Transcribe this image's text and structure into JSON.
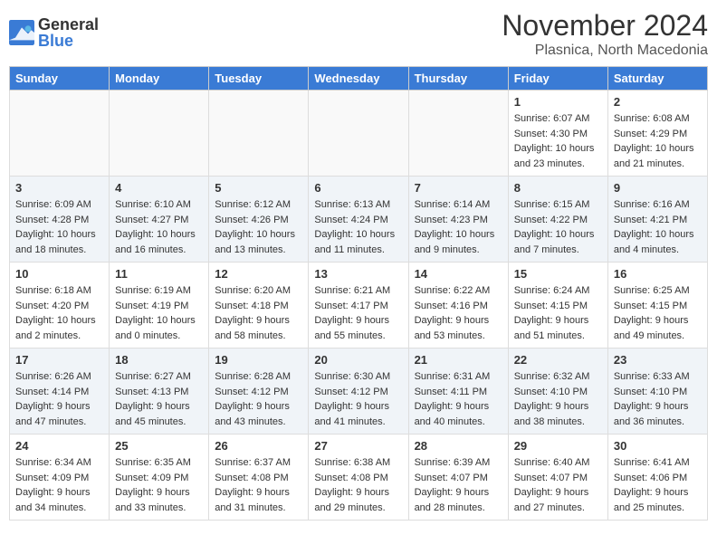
{
  "logo": {
    "general": "General",
    "blue": "Blue"
  },
  "title": "November 2024",
  "location": "Plasnica, North Macedonia",
  "days_of_week": [
    "Sunday",
    "Monday",
    "Tuesday",
    "Wednesday",
    "Thursday",
    "Friday",
    "Saturday"
  ],
  "weeks": [
    [
      {
        "day": "",
        "info": "",
        "empty": true
      },
      {
        "day": "",
        "info": "",
        "empty": true
      },
      {
        "day": "",
        "info": "",
        "empty": true
      },
      {
        "day": "",
        "info": "",
        "empty": true
      },
      {
        "day": "",
        "info": "",
        "empty": true
      },
      {
        "day": "1",
        "info": "Sunrise: 6:07 AM\nSunset: 4:30 PM\nDaylight: 10 hours and 23 minutes."
      },
      {
        "day": "2",
        "info": "Sunrise: 6:08 AM\nSunset: 4:29 PM\nDaylight: 10 hours and 21 minutes."
      }
    ],
    [
      {
        "day": "3",
        "info": "Sunrise: 6:09 AM\nSunset: 4:28 PM\nDaylight: 10 hours and 18 minutes."
      },
      {
        "day": "4",
        "info": "Sunrise: 6:10 AM\nSunset: 4:27 PM\nDaylight: 10 hours and 16 minutes."
      },
      {
        "day": "5",
        "info": "Sunrise: 6:12 AM\nSunset: 4:26 PM\nDaylight: 10 hours and 13 minutes."
      },
      {
        "day": "6",
        "info": "Sunrise: 6:13 AM\nSunset: 4:24 PM\nDaylight: 10 hours and 11 minutes."
      },
      {
        "day": "7",
        "info": "Sunrise: 6:14 AM\nSunset: 4:23 PM\nDaylight: 10 hours and 9 minutes."
      },
      {
        "day": "8",
        "info": "Sunrise: 6:15 AM\nSunset: 4:22 PM\nDaylight: 10 hours and 7 minutes."
      },
      {
        "day": "9",
        "info": "Sunrise: 6:16 AM\nSunset: 4:21 PM\nDaylight: 10 hours and 4 minutes."
      }
    ],
    [
      {
        "day": "10",
        "info": "Sunrise: 6:18 AM\nSunset: 4:20 PM\nDaylight: 10 hours and 2 minutes."
      },
      {
        "day": "11",
        "info": "Sunrise: 6:19 AM\nSunset: 4:19 PM\nDaylight: 10 hours and 0 minutes."
      },
      {
        "day": "12",
        "info": "Sunrise: 6:20 AM\nSunset: 4:18 PM\nDaylight: 9 hours and 58 minutes."
      },
      {
        "day": "13",
        "info": "Sunrise: 6:21 AM\nSunset: 4:17 PM\nDaylight: 9 hours and 55 minutes."
      },
      {
        "day": "14",
        "info": "Sunrise: 6:22 AM\nSunset: 4:16 PM\nDaylight: 9 hours and 53 minutes."
      },
      {
        "day": "15",
        "info": "Sunrise: 6:24 AM\nSunset: 4:15 PM\nDaylight: 9 hours and 51 minutes."
      },
      {
        "day": "16",
        "info": "Sunrise: 6:25 AM\nSunset: 4:15 PM\nDaylight: 9 hours and 49 minutes."
      }
    ],
    [
      {
        "day": "17",
        "info": "Sunrise: 6:26 AM\nSunset: 4:14 PM\nDaylight: 9 hours and 47 minutes."
      },
      {
        "day": "18",
        "info": "Sunrise: 6:27 AM\nSunset: 4:13 PM\nDaylight: 9 hours and 45 minutes."
      },
      {
        "day": "19",
        "info": "Sunrise: 6:28 AM\nSunset: 4:12 PM\nDaylight: 9 hours and 43 minutes."
      },
      {
        "day": "20",
        "info": "Sunrise: 6:30 AM\nSunset: 4:12 PM\nDaylight: 9 hours and 41 minutes."
      },
      {
        "day": "21",
        "info": "Sunrise: 6:31 AM\nSunset: 4:11 PM\nDaylight: 9 hours and 40 minutes."
      },
      {
        "day": "22",
        "info": "Sunrise: 6:32 AM\nSunset: 4:10 PM\nDaylight: 9 hours and 38 minutes."
      },
      {
        "day": "23",
        "info": "Sunrise: 6:33 AM\nSunset: 4:10 PM\nDaylight: 9 hours and 36 minutes."
      }
    ],
    [
      {
        "day": "24",
        "info": "Sunrise: 6:34 AM\nSunset: 4:09 PM\nDaylight: 9 hours and 34 minutes."
      },
      {
        "day": "25",
        "info": "Sunrise: 6:35 AM\nSunset: 4:09 PM\nDaylight: 9 hours and 33 minutes."
      },
      {
        "day": "26",
        "info": "Sunrise: 6:37 AM\nSunset: 4:08 PM\nDaylight: 9 hours and 31 minutes."
      },
      {
        "day": "27",
        "info": "Sunrise: 6:38 AM\nSunset: 4:08 PM\nDaylight: 9 hours and 29 minutes."
      },
      {
        "day": "28",
        "info": "Sunrise: 6:39 AM\nSunset: 4:07 PM\nDaylight: 9 hours and 28 minutes."
      },
      {
        "day": "29",
        "info": "Sunrise: 6:40 AM\nSunset: 4:07 PM\nDaylight: 9 hours and 27 minutes."
      },
      {
        "day": "30",
        "info": "Sunrise: 6:41 AM\nSunset: 4:06 PM\nDaylight: 9 hours and 25 minutes."
      }
    ]
  ]
}
